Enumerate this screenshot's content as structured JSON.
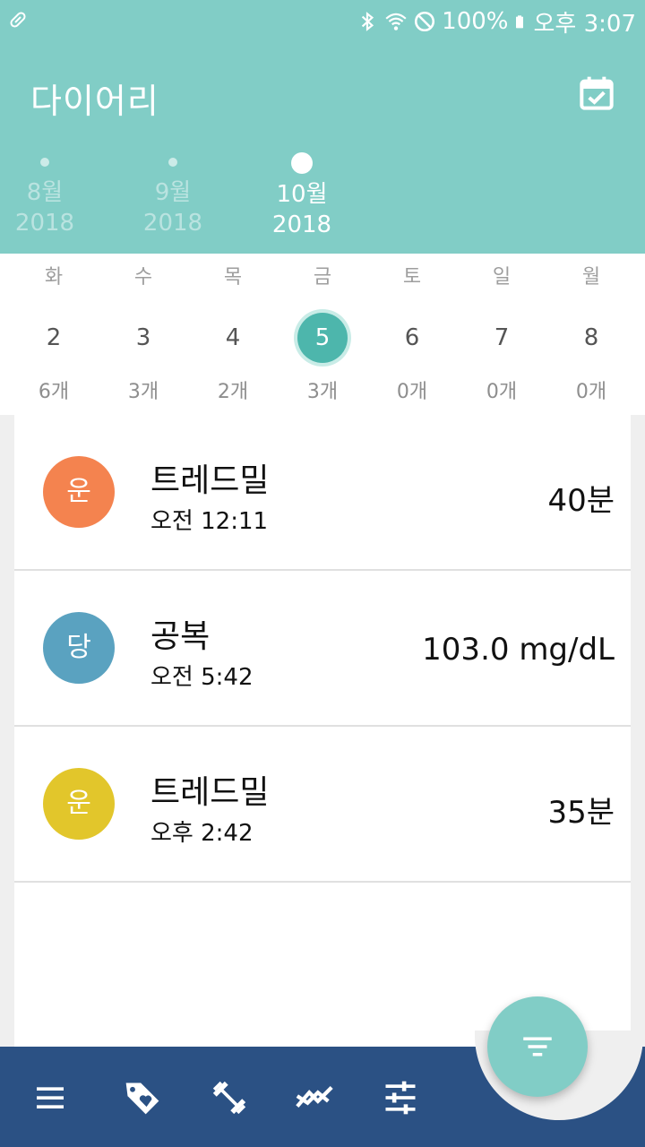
{
  "status": {
    "battery": "100%",
    "time": "오후 3:07"
  },
  "header": {
    "title": "다이어리"
  },
  "months": [
    {
      "month": "8월",
      "year": "2018"
    },
    {
      "month": "9월",
      "year": "2018"
    },
    {
      "month": "10월",
      "year": "2018"
    }
  ],
  "week": [
    {
      "weekday": "화",
      "day": "2",
      "count": "6개"
    },
    {
      "weekday": "수",
      "day": "3",
      "count": "3개"
    },
    {
      "weekday": "목",
      "day": "4",
      "count": "2개"
    },
    {
      "weekday": "금",
      "day": "5",
      "count": "3개"
    },
    {
      "weekday": "토",
      "day": "6",
      "count": "0개"
    },
    {
      "weekday": "일",
      "day": "7",
      "count": "0개"
    },
    {
      "weekday": "월",
      "day": "8",
      "count": "0개"
    }
  ],
  "entries": [
    {
      "badge": "운",
      "badge_color": "#f4834f",
      "name": "트레드밀",
      "time": "오전 12:11",
      "value": "40분"
    },
    {
      "badge": "당",
      "badge_color": "#5aa2c0",
      "name": "공복",
      "time": "오전 5:42",
      "value": "103.0 mg/dL"
    },
    {
      "badge": "운",
      "badge_color": "#e2c62b",
      "name": "트레드밀",
      "time": "오후 2:42",
      "value": "35분"
    }
  ],
  "colors": {
    "accent": "#81cdc6",
    "selected_day": "#4db6ac",
    "bottom_bar": "#2b5184"
  },
  "bottom_nav": [
    "menu-icon",
    "tag-heart-icon",
    "dumbbell-icon",
    "trend-icon",
    "sliders-icon"
  ],
  "fab_icon": "filter-icon"
}
